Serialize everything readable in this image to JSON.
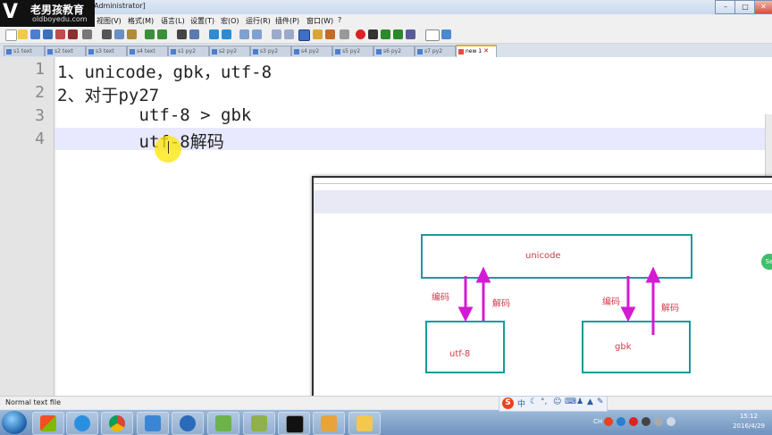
{
  "window": {
    "title": "[Administrator]",
    "controls": [
      "–",
      "□",
      "✕"
    ]
  },
  "logo": {
    "name": "老男孩教育",
    "url": "oldboyedu.com"
  },
  "menu": [
    "视图(V)",
    "格式(M)",
    "语言(L)",
    "设置(T)",
    "宏(O)",
    "运行(R)",
    "插件(P)",
    "窗口(W)",
    "?"
  ],
  "tabs": [
    {
      "label": "s1 text"
    },
    {
      "label": "s2 text"
    },
    {
      "label": "s3 text"
    },
    {
      "label": "s4 text"
    },
    {
      "label": "s1 py2"
    },
    {
      "label": "s2 py2"
    },
    {
      "label": "s3 py2"
    },
    {
      "label": "s4 py2"
    },
    {
      "label": "s5 py2"
    },
    {
      "label": "s6 py2"
    },
    {
      "label": "s7 py2"
    },
    {
      "label": "new 1",
      "active": true
    }
  ],
  "editor": {
    "line_numbers": [
      "1",
      "2",
      "3",
      "4"
    ],
    "lines": [
      "1、unicode，gbk，utf-8",
      "2、对于py27",
      "        utf-8 > gbk",
      "        utf-8解码"
    ],
    "current_line": 4
  },
  "status": {
    "file_type": "Normal text file"
  },
  "diagram": {
    "unicode_label": "unicode",
    "utf8_label": "utf-8",
    "gbk_label": "gbk",
    "encode_left": "编码",
    "decode_left": "解码",
    "encode_right": "编码",
    "decode_right": "解码",
    "arrow_color": "#d51ad5",
    "box_color": "#1a9a9a"
  },
  "ime": {
    "logo": "S",
    "mode": "中"
  },
  "taskbar": {
    "lang": "CH",
    "time": "15:12",
    "date": "2016/4/29"
  }
}
